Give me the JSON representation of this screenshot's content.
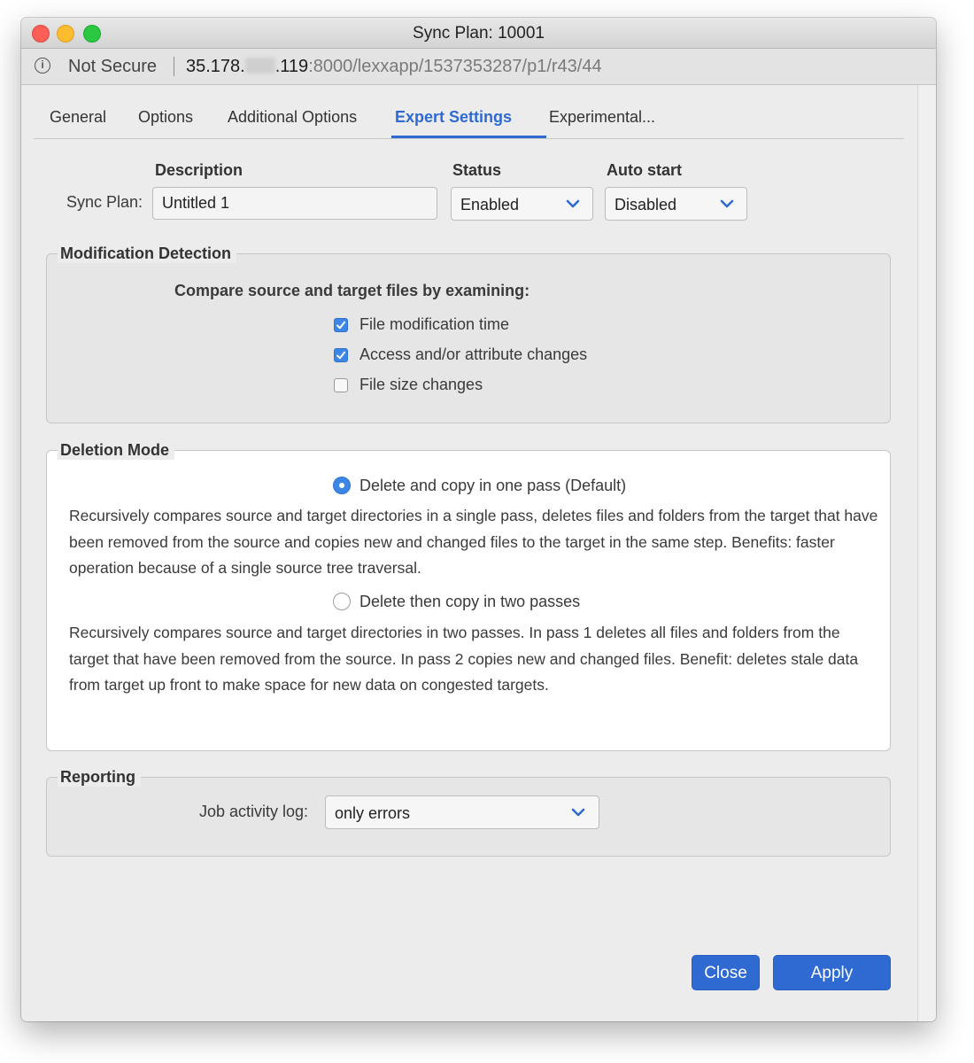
{
  "window": {
    "title": "Sync Plan: 10001"
  },
  "address_bar": {
    "security_label": "Not Secure",
    "url_prefix": "35.178.",
    "url_suffix": ".119",
    "url_rest": ":8000/lexxapp/1537353287/p1/r43/44"
  },
  "tabs": [
    {
      "label": "General",
      "active": false
    },
    {
      "label": "Options",
      "active": false
    },
    {
      "label": "Additional Options",
      "active": false
    },
    {
      "label": "Expert Settings",
      "active": true
    },
    {
      "label": "Experimental...",
      "active": false
    }
  ],
  "plan": {
    "description_header": "Description",
    "status_header": "Status",
    "autostart_header": "Auto start",
    "sync_plan_label": "Sync Plan:",
    "description_value": "Untitled 1",
    "status_value": "Enabled",
    "autostart_value": "Disabled"
  },
  "modification": {
    "title": "Modification Detection",
    "prompt": "Compare source and target files by examining:",
    "options": [
      {
        "label": "File modification time",
        "checked": true
      },
      {
        "label": "Access and/or attribute changes",
        "checked": true
      },
      {
        "label": "File size changes",
        "checked": false
      }
    ]
  },
  "deletion": {
    "title": "Deletion Mode",
    "options": [
      {
        "label": "Delete and copy in one pass (Default)",
        "selected": true,
        "description": "Recursively compares source and target directories in a single pass, deletes files and folders from the target that have been removed from the source and copies new and changed files to the target in the same step. Benefits: faster operation because of a single source tree traversal."
      },
      {
        "label": "Delete then copy in two passes",
        "selected": false,
        "description": "Recursively compares source and target directories in two passes. In pass 1 deletes all files and folders from the target that have been removed from the source. In pass 2 copies new and changed files. Benefit: deletes stale data from target up front to make space for new data on congested targets."
      }
    ]
  },
  "reporting": {
    "title": "Reporting",
    "log_label": "Job activity log:",
    "log_value": "only errors"
  },
  "buttons": {
    "close": "Close",
    "apply": "Apply"
  },
  "colors": {
    "accent": "#2f6ad3",
    "checkbox": "#3c87e6"
  }
}
